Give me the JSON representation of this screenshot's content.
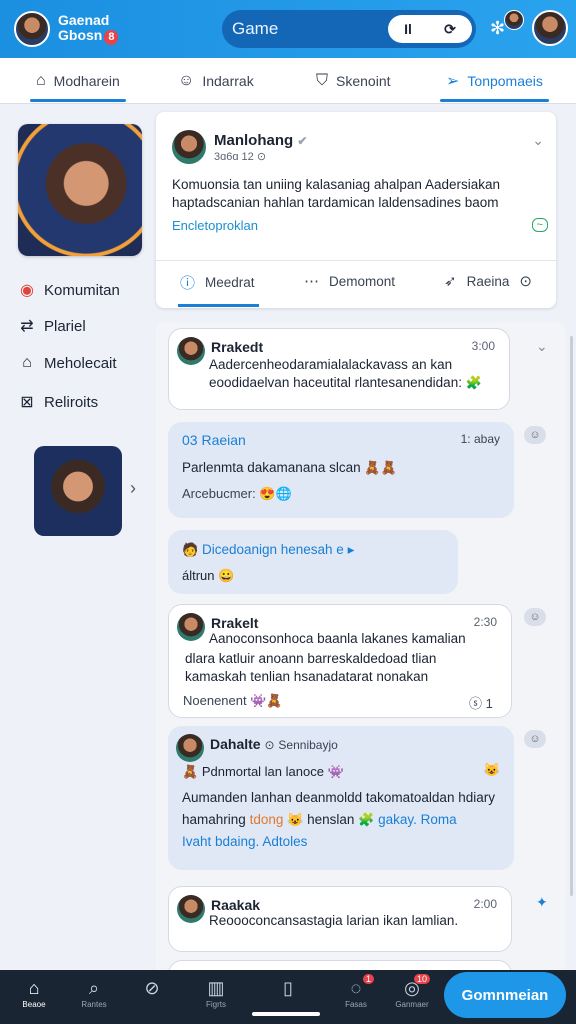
{
  "header": {
    "brand_line1": "Gaenad",
    "brand_line2": "Gbosn",
    "brand_badge": "8",
    "game_label": "Game",
    "seg_left": "Il",
    "seg_right": "⟳"
  },
  "tabs": [
    {
      "label": "Modharein",
      "icon": "home-icon"
    },
    {
      "label": "Indarrak",
      "icon": "smile-icon"
    },
    {
      "label": "Skenoint",
      "icon": "person-icon"
    },
    {
      "label": "Tonpomaeis",
      "icon": "send-icon"
    }
  ],
  "sidebar": {
    "items": [
      {
        "label": "Komumitan",
        "icon": "target-icon"
      },
      {
        "label": "Plariel",
        "icon": "swap-icon"
      },
      {
        "label": "Meholecait",
        "icon": "home-icon"
      },
      {
        "label": "Reliroits",
        "icon": "chart-icon"
      }
    ]
  },
  "post": {
    "author": "Manlohang",
    "sub": "3ɑ6ɑ 12",
    "body": "Komuonsia tan uniing kalasaniag ahalpan Aadersiakan haptadscanian hahlan tardamican laldensadines baom",
    "link": "Encletoproklan",
    "tag": "~",
    "actions": [
      {
        "label": "Meedrat",
        "icon": "info-icon"
      },
      {
        "label": "Demomont",
        "icon": "dots-icon"
      },
      {
        "label": "Raeina",
        "icon": "share-icon"
      }
    ]
  },
  "messages": {
    "m1": {
      "author": "Rrakedt",
      "time": "3:00",
      "text1": "Aadercenheodaramialalackavass an kan",
      "text2": "eoodidaelvan haceutital rlantesanendidan:"
    },
    "m2": {
      "author": "03 Raeian",
      "time": "1: abay",
      "text": "Parlenmta dakamanana slcan",
      "sub": "Arcebucmer:"
    },
    "m3": {
      "author": "Dicedoanign henesah e",
      "sub": "áltrun"
    },
    "m4": {
      "author": "Rrakelt",
      "time": "2:30",
      "text1": "Aanoconsonhoca baanla lakanes kamalian",
      "text2": "dlara katluir anoann barreskaldedoad tlian",
      "text3": "kamaskah tenlian hsanadatarat nonakan",
      "sub": "Noenenent",
      "count": "1"
    },
    "m5": {
      "author": "Dahalte",
      "sub_author": "Sennibayjo",
      "line1": "Pdnmortal lan lanoce",
      "line2": "Aumanden lanhan deanmoldd takomatoaldan hdiary",
      "line3a": "hamahring",
      "line3b": "tdong",
      "line3c": "henslan",
      "line3d": "gakay. Roma",
      "line4": "Ivaht bdaing. Adtoles"
    },
    "m6": {
      "author": "Raakak",
      "time": "2:00",
      "text": "Reoooconcansastagia larian ikan lamlian."
    }
  },
  "bottom_nav": [
    {
      "label": "Beaoe",
      "icon": "home-icon"
    },
    {
      "label": "Rantes",
      "icon": "search-icon"
    },
    {
      "label": "",
      "icon": "compass-icon"
    },
    {
      "label": "Figrts",
      "icon": "book-icon"
    },
    {
      "label": "",
      "icon": "phone-icon"
    },
    {
      "label": "Fasas",
      "icon": "chat-icon",
      "badge": "1"
    },
    {
      "label": "Ganmaer",
      "icon": "bell-icon",
      "badge": "10"
    }
  ],
  "cta": "Gomnmeian",
  "colors": {
    "accent": "#1b8fe0",
    "bubble": "#dfe8f4",
    "nav": "#1a2533"
  }
}
